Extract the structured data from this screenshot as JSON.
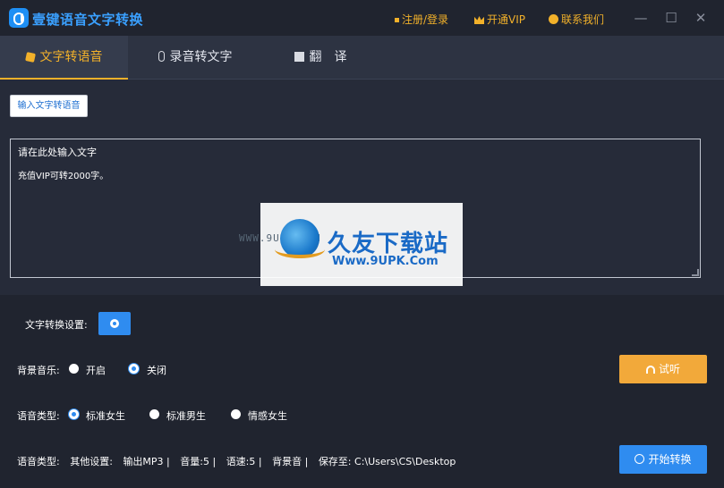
{
  "app": {
    "title": "壹键语音文字转换",
    "links": {
      "register": "注册/登录",
      "vip": "开通VIP",
      "contact": "联系我们"
    },
    "window": {
      "minimize": "—",
      "maximize": "☐",
      "close": "✕"
    }
  },
  "tabs": [
    {
      "label": "文字转语音",
      "active": true
    },
    {
      "label": "录音转文字",
      "active": false
    },
    {
      "label": "翻　译",
      "active": false
    }
  ],
  "input": {
    "type_button": "输入文字转语音",
    "placeholder": "请在此处输入文字",
    "vip_hint": "充值VIP可转2000字。"
  },
  "watermark": {
    "url_small": "WWW.9UPK.COM",
    "brand": "久友下载站",
    "url": "Www.9UPK.Com"
  },
  "settings": {
    "convert_settings_label": "文字转换设置:",
    "bg_music": {
      "label": "背景音乐:",
      "options": [
        "开启",
        "关闭"
      ],
      "selected": "关闭"
    },
    "voice_type": {
      "label": "语音类型:",
      "options": [
        "标准女生",
        "标准男生",
        "情感女生"
      ],
      "selected": "标准女生"
    },
    "listen_button": "试听",
    "start_button": "开始转换",
    "info": {
      "label": "语音类型:",
      "other": "其他设置:",
      "output": "输出MP3 |",
      "volume": "音量:5 |",
      "speed": "语速:5 |",
      "bgm": "背景音 |",
      "save": "保存至: C:\\Users\\CS\\Desktop"
    }
  },
  "colors": {
    "accent_orange": "#f2b12a",
    "accent_blue": "#2f8cf0",
    "brand_blue": "#3aa0ff",
    "background": "#262b39"
  }
}
